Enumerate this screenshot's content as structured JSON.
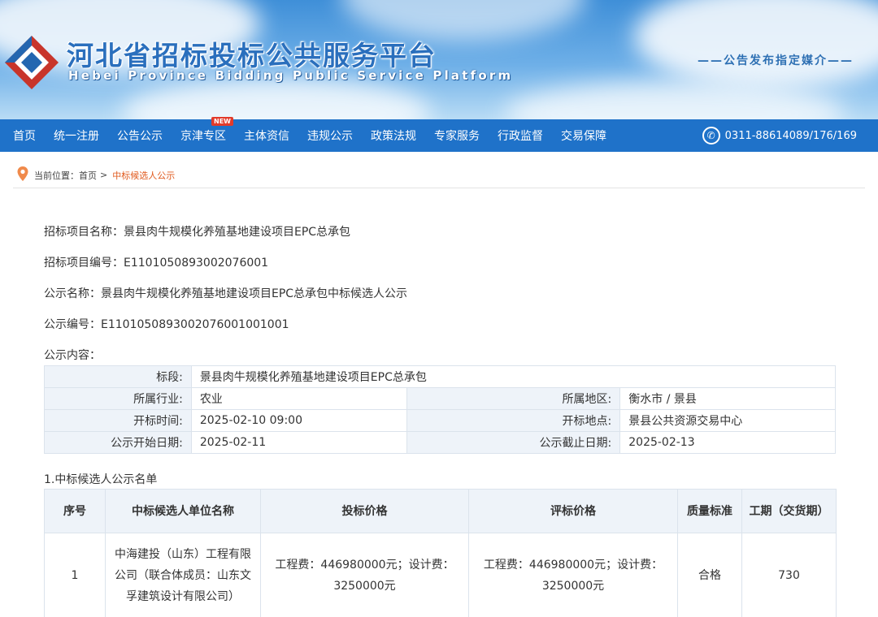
{
  "header": {
    "title": "河北省招标投标公共服务平台",
    "subtitle": "Hebei Province Bidding Public Service Platform",
    "slogan": "——公告发布指定媒介——"
  },
  "nav": {
    "items": [
      {
        "label": "首页"
      },
      {
        "label": "统一注册"
      },
      {
        "label": "公告公示"
      },
      {
        "label": "京津专区",
        "badge": "NEW"
      },
      {
        "label": "主体资信"
      },
      {
        "label": "违规公示"
      },
      {
        "label": "政策法规"
      },
      {
        "label": "专家服务"
      },
      {
        "label": "行政监督"
      },
      {
        "label": "交易保障"
      }
    ],
    "hotline": "0311-88614089/176/169"
  },
  "breadcrumb": {
    "prefix": "当前位置：",
    "home": "首页",
    "separator": ">",
    "current": "中标候选人公示"
  },
  "fields": {
    "project_name": "招标项目名称：景县肉牛规模化养殖基地建设项目EPC总承包",
    "project_code": "招标项目编号：E1101050893002076001",
    "notice_name": "公示名称：景县肉牛规模化养殖基地建设项目EPC总承包中标候选人公示",
    "notice_code": "公示编号：E1101050893002076001001001",
    "content_label": "公示内容："
  },
  "info": {
    "section_label": "标段:",
    "section_value": "景县肉牛规模化养殖基地建设项目EPC总承包",
    "industry_label": "所属行业:",
    "industry_value": "农业",
    "region_label": "所属地区:",
    "region_value": "衡水市 / 景县",
    "open_time_label": "开标时间:",
    "open_time_value": "2025-02-10 09:00",
    "open_place_label": "开标地点:",
    "open_place_value": "景县公共资源交易中心",
    "start_date_label": "公示开始日期:",
    "start_date_value": "2025-02-11",
    "end_date_label": "公示截止日期:",
    "end_date_value": "2025-02-13"
  },
  "candidates": {
    "title": "1.中标候选人公示名单",
    "headers": [
      "序号",
      "中标候选人单位名称",
      "投标价格",
      "评标价格",
      "质量标准",
      "工期（交货期）"
    ],
    "rows": [
      [
        "1",
        "中海建投（山东）工程有限公司（联合体成员：山东文孚建筑设计有限公司）",
        "工程费：446980000元；设计费：3250000元",
        "工程费：446980000元；设计费：3250000元",
        "合格",
        "730"
      ]
    ]
  },
  "colors": {
    "nav_bg": "#1f72c9",
    "breadcrumb_current": "#e05a1e",
    "label_cell_bg": "#eef3f9"
  }
}
